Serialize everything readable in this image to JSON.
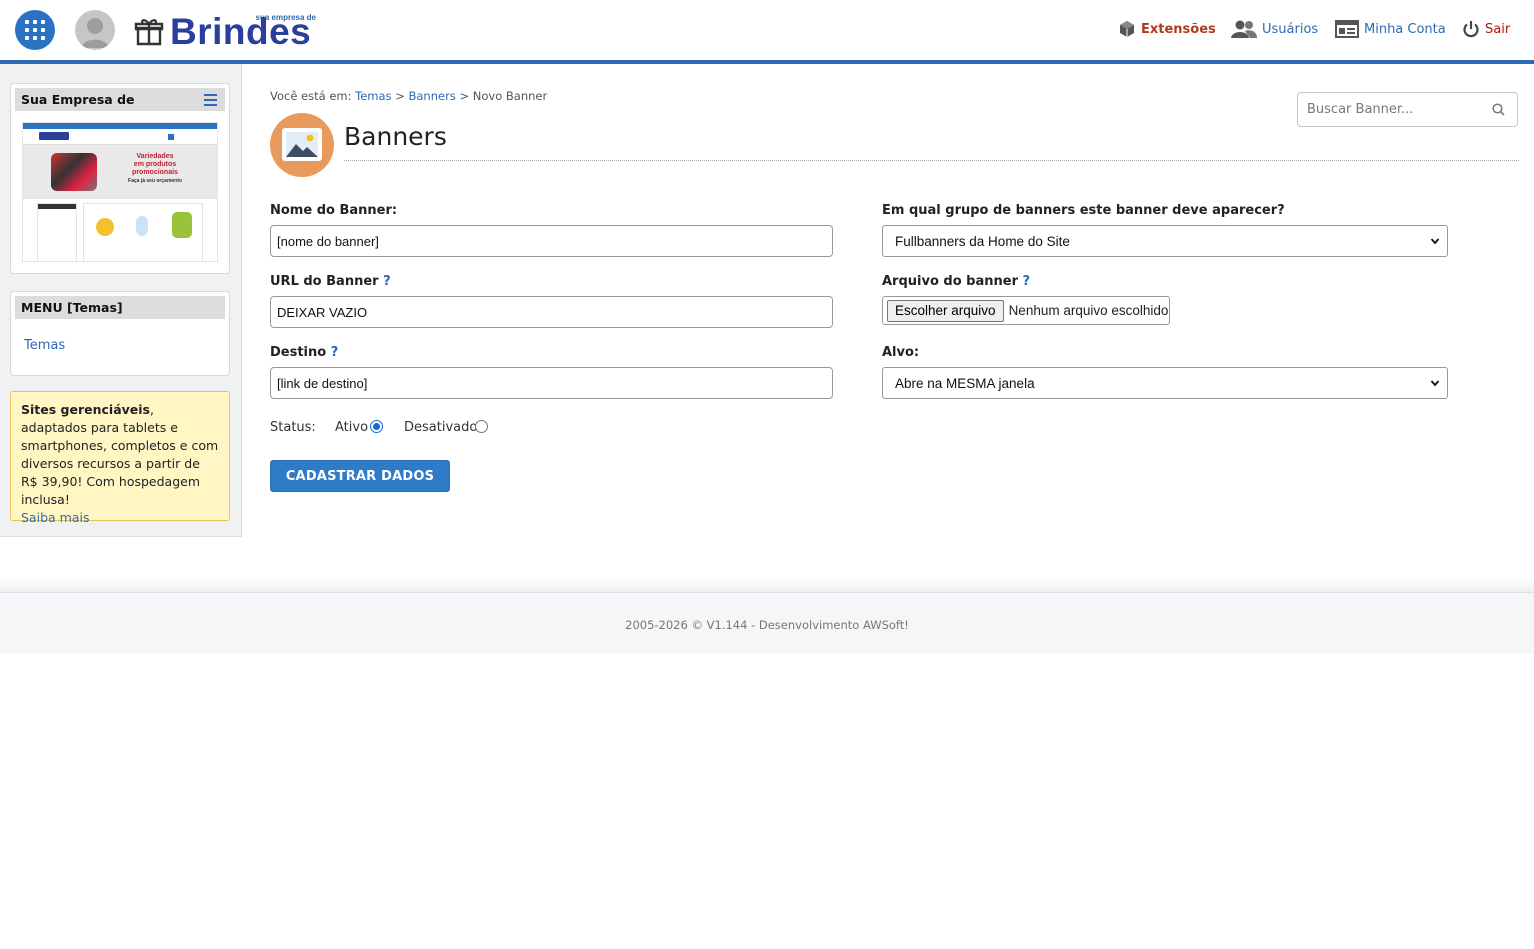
{
  "header": {
    "logo_tag": "sua empresa de",
    "logo_text": "Brindes",
    "nav": {
      "extensions": "Extensões",
      "users": "Usuários",
      "account": "Minha Conta",
      "exit": "Sair"
    }
  },
  "sidebar": {
    "site_box_title": "Sua Empresa de",
    "menu_title": "MENU [Temas]",
    "menu_items": [
      {
        "label": "Temas"
      }
    ],
    "promo": {
      "bold": "Sites gerenciáveis",
      "text": ", adaptados para tablets e smartphones, completos e com diversos recursos a partir de R$ 39,90! Com hospedagem inclusa!",
      "link": "Saiba mais"
    },
    "thumbnail_text": {
      "line1": "Variedades",
      "line2": "em produtos",
      "line3": "promocionais",
      "line4": "Faça já seu orçamento"
    }
  },
  "breadcrumb": {
    "prefix": "Você está em:",
    "items": [
      "Temas",
      "Banners"
    ],
    "current": "Novo Banner",
    "sep": ">"
  },
  "search": {
    "placeholder": "Buscar Banner..."
  },
  "page": {
    "title": "Banners"
  },
  "form": {
    "name_label": "Nome do Banner:",
    "name_value": "[nome do banner]",
    "url_label": "URL do Banner",
    "url_value": "DEIXAR VAZIO",
    "dest_label": "Destino",
    "dest_value": "[link de destino]",
    "help_mark": "?",
    "group_label": "Em qual grupo de banners este banner deve aparecer?",
    "group_value": "Fullbanners da Home do Site",
    "file_label": "Arquivo do banner",
    "file_button": "Escolher arquivo",
    "file_status": "Nenhum arquivo escolhido",
    "target_label": "Alvo:",
    "target_value": "Abre na MESMA janela",
    "status_label": "Status:",
    "status_active": "Ativo",
    "status_inactive": "Desativado",
    "status_selected": "Ativo",
    "submit": "CADASTRAR DADOS"
  },
  "footer": {
    "text": "2005-2026 © V1.144 - Desenvolvimento AWSoft!"
  },
  "colors": {
    "brand_blue": "#2e6ab2",
    "extensions_red": "#b03a1e",
    "exit_red": "#b01414",
    "promo_bg": "#fff6c4",
    "page_icon_bg": "#e89a5c"
  }
}
